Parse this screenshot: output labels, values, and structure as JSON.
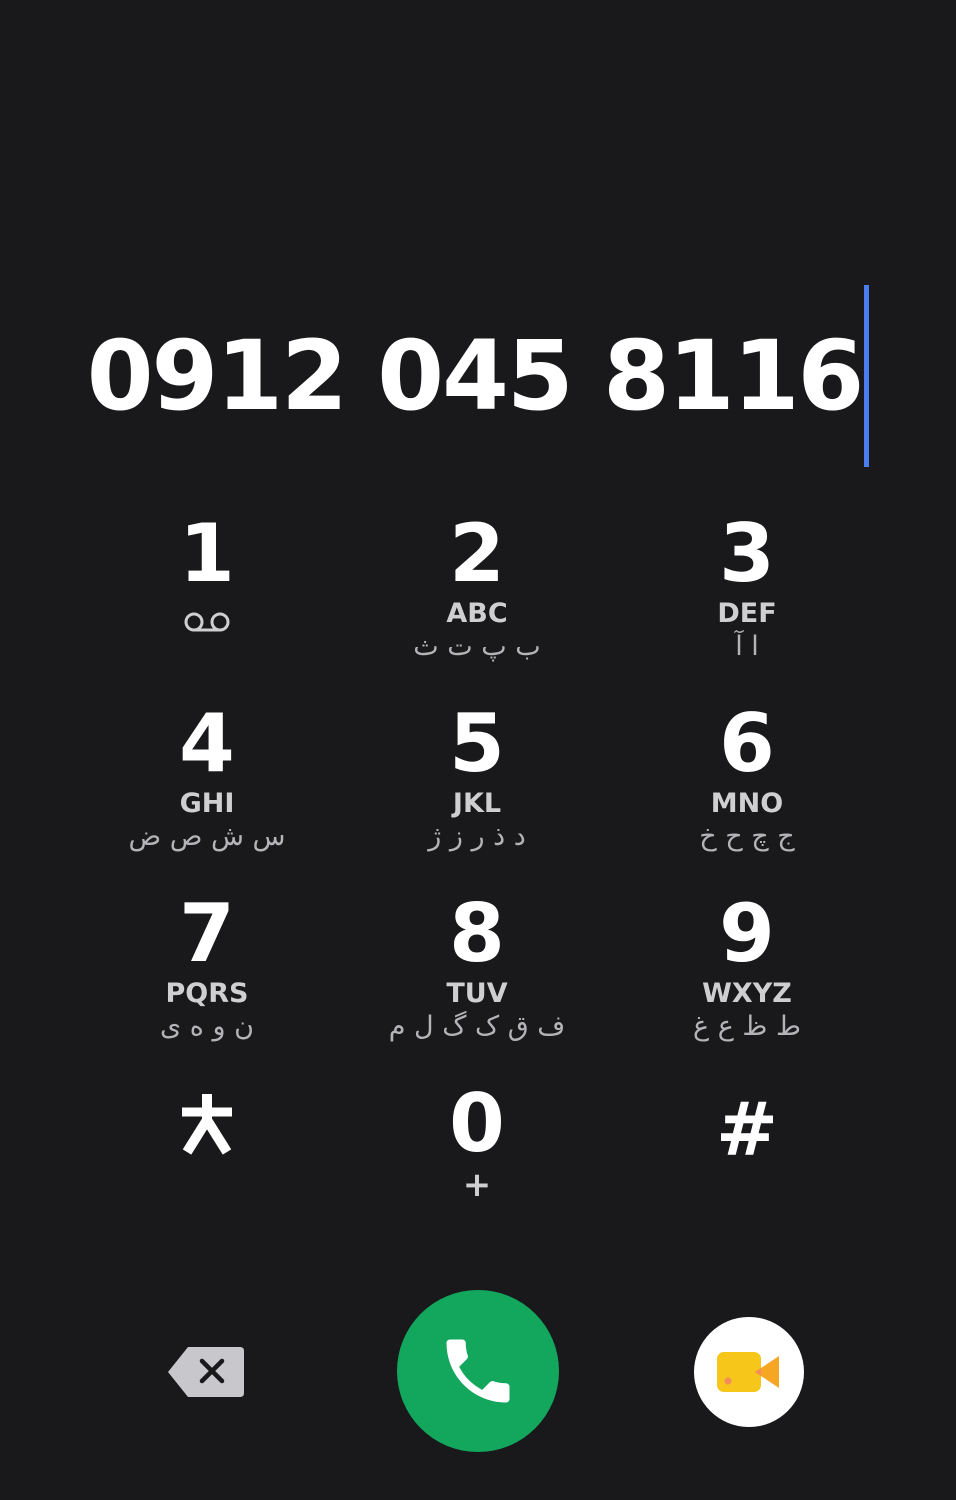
{
  "dialer": {
    "number": "0912 045 8116"
  },
  "keypad": [
    {
      "digit": "1",
      "letters": "",
      "alt": "",
      "icon": "voicemail-icon"
    },
    {
      "digit": "2",
      "letters": "ABC",
      "alt": "ب پ ت ث"
    },
    {
      "digit": "3",
      "letters": "DEF",
      "alt": "ا آ"
    },
    {
      "digit": "4",
      "letters": "GHI",
      "alt": "س ش ص ض"
    },
    {
      "digit": "5",
      "letters": "JKL",
      "alt": "د ذ ر ز ژ"
    },
    {
      "digit": "6",
      "letters": "MNO",
      "alt": "ج چ ح خ"
    },
    {
      "digit": "7",
      "letters": "PQRS",
      "alt": "ن و ه ی"
    },
    {
      "digit": "8",
      "letters": "TUV",
      "alt": "ف ق ک گ ل م"
    },
    {
      "digit": "9",
      "letters": "WXYZ",
      "alt": "ط ظ ع غ"
    },
    {
      "digit": "*",
      "letters": "",
      "alt": "",
      "icon": "asterisk-icon"
    },
    {
      "digit": "0",
      "letters": "+",
      "alt": ""
    },
    {
      "digit": "#",
      "letters": "",
      "alt": ""
    }
  ],
  "actions": {
    "backspace_icon": "backspace-icon",
    "call_icon": "phone-icon",
    "video_icon": "video-call-icon"
  },
  "colors": {
    "background": "#19191b",
    "caret": "#4a7df0",
    "call_button": "#12a75d",
    "video_icon_yellow": "#f7c61a",
    "video_icon_orange": "#f5a623"
  }
}
